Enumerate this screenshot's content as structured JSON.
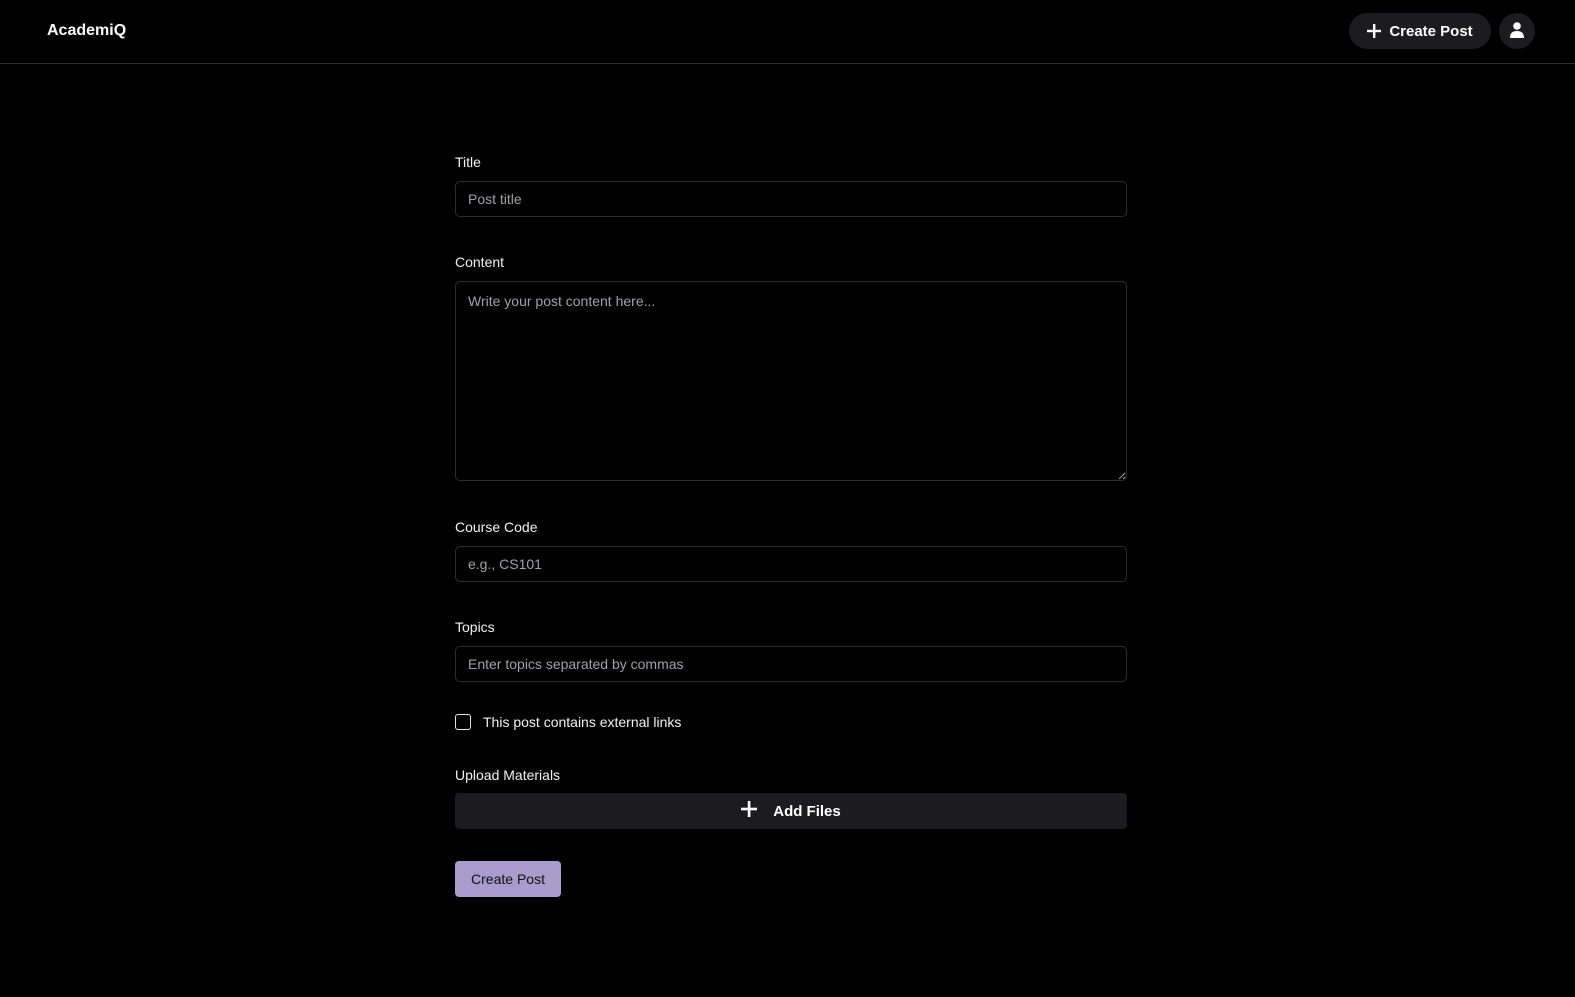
{
  "header": {
    "brand": "AcademiQ",
    "create_post_label": "Create Post"
  },
  "form": {
    "title": {
      "label": "Title",
      "placeholder": "Post title"
    },
    "content": {
      "label": "Content",
      "placeholder": "Write your post content here..."
    },
    "course_code": {
      "label": "Course Code",
      "placeholder": "e.g., CS101"
    },
    "topics": {
      "label": "Topics",
      "placeholder": "Enter topics separated by commas"
    },
    "external_links": {
      "label": "This post contains external links",
      "checked": false
    },
    "upload": {
      "label": "Upload Materials",
      "button_label": "Add Files"
    },
    "submit_label": "Create Post"
  },
  "colors": {
    "background": "#000000",
    "surface": "#1c1c1e",
    "border": "#2e2e31",
    "accent": "#a99bcc"
  },
  "icons": {
    "header_create": "plus-icon",
    "avatar": "user-icon",
    "add_files": "plus-icon"
  }
}
